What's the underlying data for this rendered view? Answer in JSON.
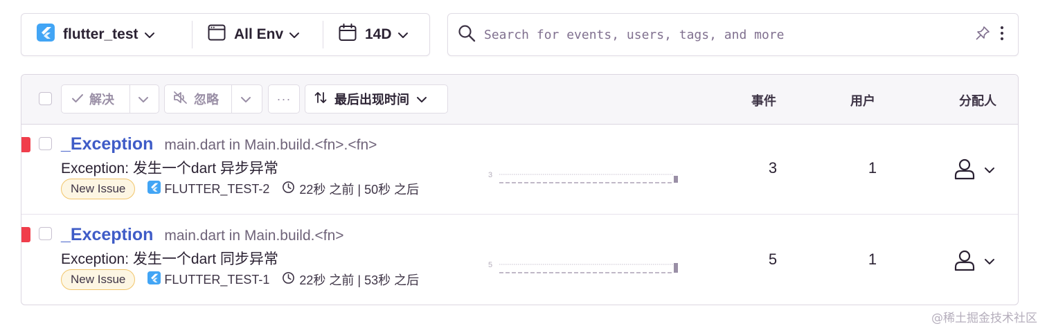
{
  "filters": {
    "project": "flutter_test",
    "environment": "All Env",
    "date_range": "14D"
  },
  "search": {
    "placeholder": "Search for events, users, tags, and more"
  },
  "toolbar": {
    "resolve_label": "解决",
    "ignore_label": "忽略",
    "more_label": "···",
    "sort_label": "最后出现时间"
  },
  "columns": {
    "events": "事件",
    "users": "用户",
    "assignee": "分配人"
  },
  "issues": [
    {
      "title": "_Exception",
      "culprit": "main.dart in Main.build.<fn>.<fn>",
      "message": "Exception: 发生一个dart 异步异常",
      "badge": "New Issue",
      "short_id": "FLUTTER_TEST-2",
      "times": "22秒 之前 | 50秒 之后",
      "spark_max": "3",
      "events": "3",
      "users": "1"
    },
    {
      "title": "_Exception",
      "culprit": "main.dart in Main.build.<fn>",
      "message": "Exception: 发生一个dart 同步异常",
      "badge": "New Issue",
      "short_id": "FLUTTER_TEST-1",
      "times": "22秒 之前 | 53秒 之后",
      "spark_max": "5",
      "events": "5",
      "users": "1"
    }
  ],
  "watermark": "@稀土掘金技术社区",
  "colors": {
    "accent_link": "#3f5cc7",
    "level_error": "#f03e4c",
    "badge_border": "#f1c56a",
    "flutter_blue": "#42a5f5"
  },
  "icons": [
    "flutter-icon",
    "browser-window-icon",
    "calendar-icon",
    "search-icon",
    "pin-icon",
    "kebab-icon",
    "check-icon",
    "mute-icon",
    "sort-icon",
    "clock-icon",
    "user-icon",
    "chevron-down-icon"
  ]
}
